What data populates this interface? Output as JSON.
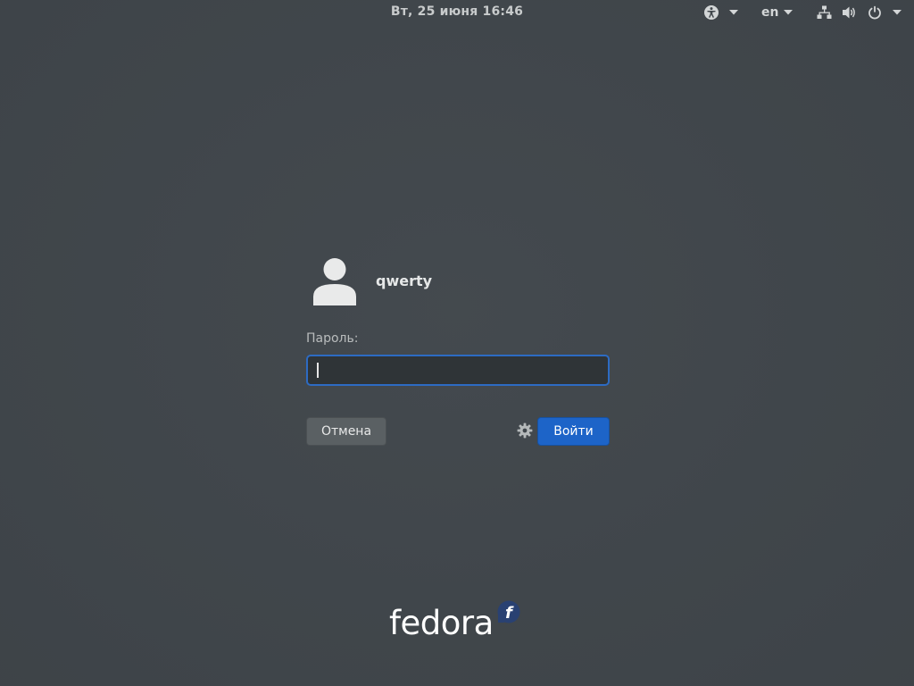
{
  "topbar": {
    "datetime": "Вт, 25 июня  16:46",
    "accessibility_icon": "accessibility-icon",
    "language": "en",
    "network_icon": "network-wired-icon",
    "volume_icon": "volume-icon",
    "power_icon": "power-icon"
  },
  "login": {
    "username": "qwerty",
    "password_label": "Пароль:",
    "password_value": "",
    "cancel_label": "Отмена",
    "login_label": "Войти",
    "settings_icon": "gear-icon"
  },
  "branding": {
    "logo_text": "fedora",
    "logo_mark_letter": "f"
  },
  "colors": {
    "background": "#40464b",
    "accent": "#1d64c8",
    "focus_border": "#2d6bc3",
    "fedora_blue": "#294172"
  }
}
